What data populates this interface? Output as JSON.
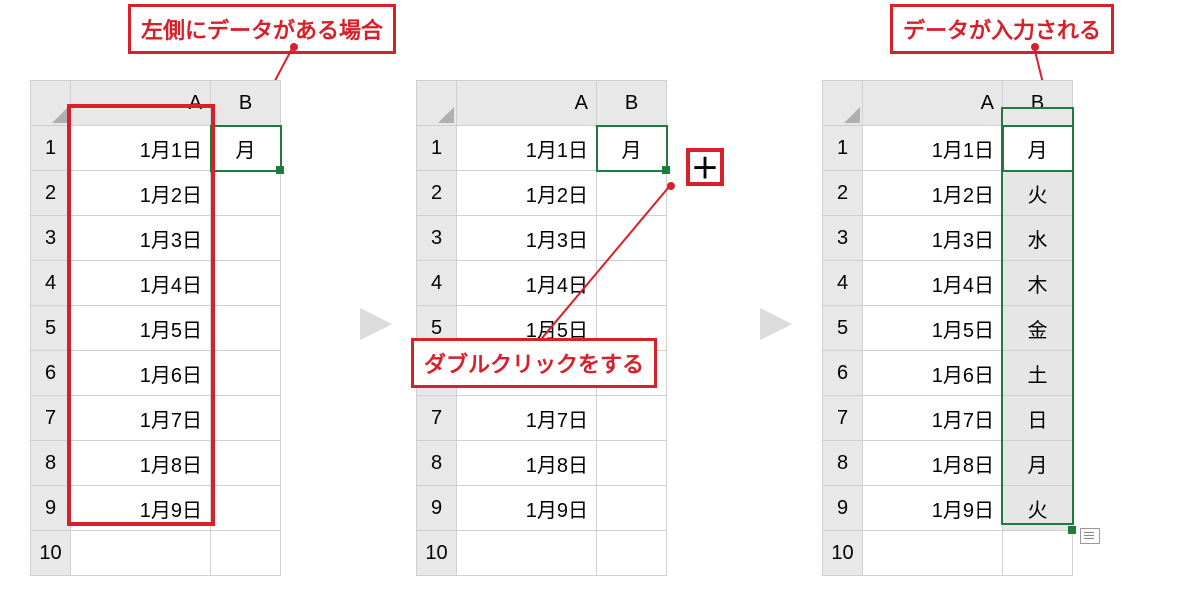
{
  "callouts": {
    "left": "左側にデータがある場合",
    "mid": "ダブルクリックをする",
    "right": "データが入力される"
  },
  "columns": {
    "A": "A",
    "B": "B"
  },
  "rows": [
    "1",
    "2",
    "3",
    "4",
    "5",
    "6",
    "7",
    "8",
    "9",
    "10"
  ],
  "sheet1": {
    "A": [
      "1月1日",
      "1月2日",
      "1月3日",
      "1月4日",
      "1月5日",
      "1月6日",
      "1月7日",
      "1月8日",
      "1月9日",
      ""
    ],
    "B": [
      "月",
      "",
      "",
      "",
      "",
      "",
      "",
      "",
      "",
      ""
    ]
  },
  "sheet2": {
    "A": [
      "1月1日",
      "1月2日",
      "1月3日",
      "1月4日",
      "1月5日",
      "1月6日",
      "1月7日",
      "1月8日",
      "1月9日",
      ""
    ],
    "B": [
      "月",
      "",
      "",
      "",
      "",
      "",
      "",
      "",
      "",
      ""
    ]
  },
  "sheet3": {
    "A": [
      "1月1日",
      "1月2日",
      "1月3日",
      "1月4日",
      "1月5日",
      "1月6日",
      "1月7日",
      "1月8日",
      "1月9日",
      ""
    ],
    "B": [
      "火",
      "水",
      "木",
      "金",
      "土",
      "日",
      "月",
      "火",
      ""
    ],
    "B1": "月"
  },
  "fill_cursor": "＋"
}
